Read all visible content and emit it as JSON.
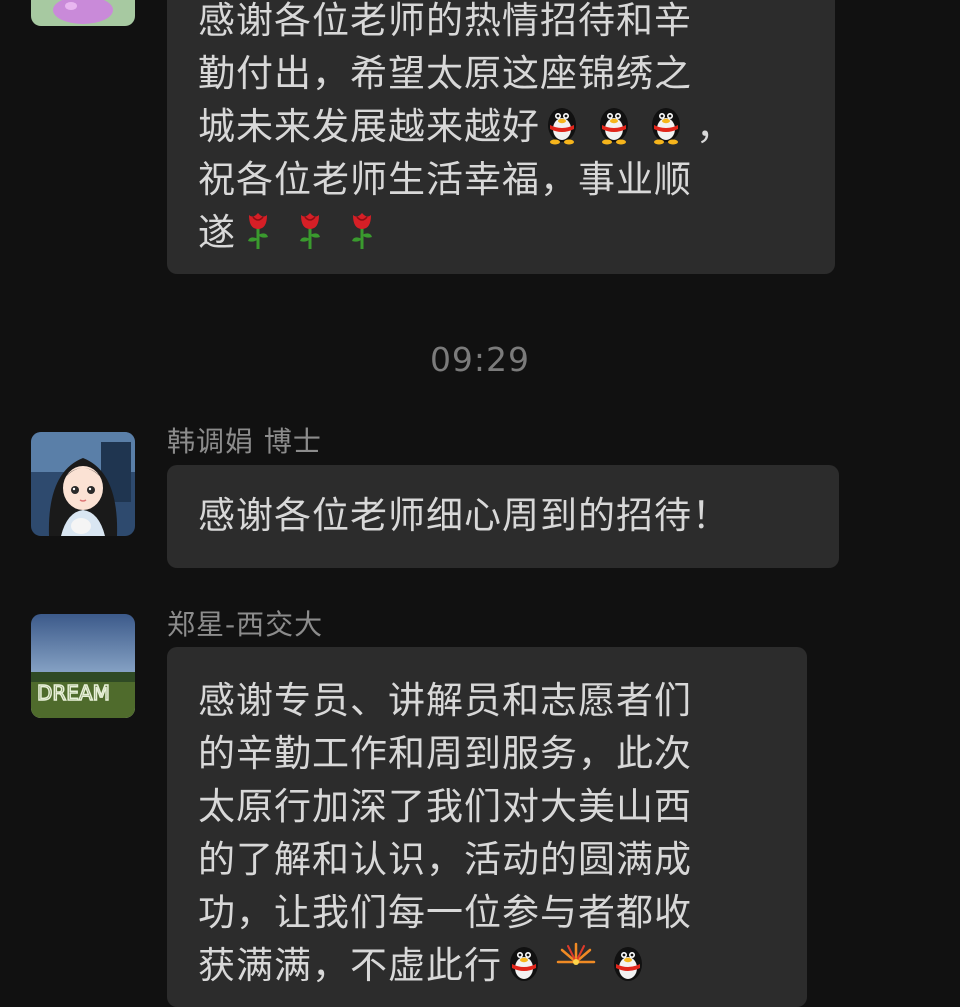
{
  "messages": [
    {
      "sender": "",
      "avatar_icon": "pink-cartoon-avatar-icon",
      "lines": [
        "感谢各位老师的热情招待和辛",
        "勤付出，希望太原这座锦绣之",
        "城未来发展越来越好",
        "，",
        "祝各位老师生活幸福，事业顺",
        "遂"
      ],
      "emojis": {
        "line3": [
          "penguin-emoji-icon",
          "penguin-emoji-icon",
          "penguin-emoji-icon"
        ],
        "line6": [
          "rose-emoji-icon",
          "rose-emoji-icon",
          "rose-emoji-icon"
        ]
      }
    },
    {
      "sender": "韩调娟 博士",
      "avatar_icon": "anime-girl-avatar-icon",
      "lines": [
        "感谢各位老师细心周到的招待！"
      ]
    },
    {
      "sender": "郑星-西交大",
      "avatar_icon": "dream-landscape-avatar-icon",
      "lines": [
        "感谢专员、讲解员和志愿者们",
        "的辛勤工作和周到服务，此次",
        "太原行加深了我们对大美山西",
        "的了解和认识，活动的圆满成",
        "功，让我们每一位参与者都收",
        "获满满，不虚此行"
      ],
      "emojis": {
        "line6": [
          "penguin-emoji-icon",
          "firework-emoji-icon",
          "penguin-emoji-icon"
        ]
      }
    }
  ],
  "timestamp": "09:29",
  "colors": {
    "background": "#111111",
    "bubble": "#2c2c2c",
    "text": "#d8d8d8",
    "meta_text": "#8c8c8c"
  }
}
